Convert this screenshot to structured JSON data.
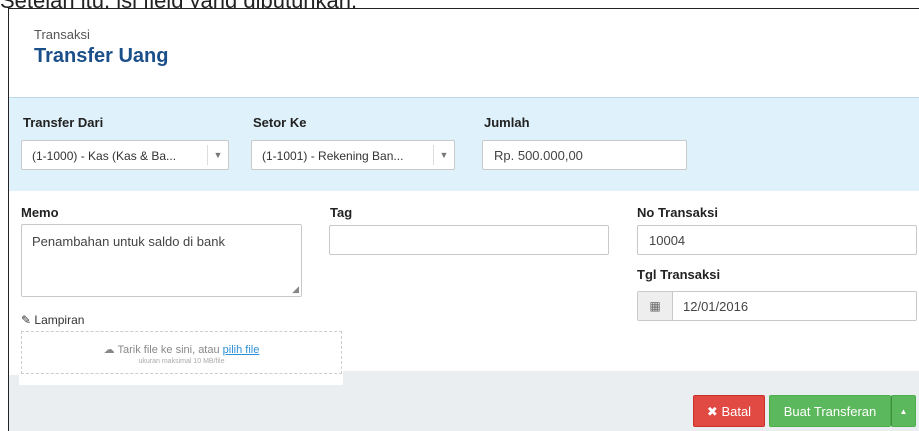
{
  "caption": "Setelah itu, isi field yang dibutuhkan.",
  "header": {
    "subtitle": "Transaksi",
    "title": "Transfer Uang"
  },
  "transfer": {
    "from_label": "Transfer Dari",
    "from_value": "(1-1000) - Kas (Kas & Ba...",
    "to_label": "Setor Ke",
    "to_value": "(1-1001) - Rekening Ban...",
    "amount_label": "Jumlah",
    "amount_value": "Rp. 500.000,00"
  },
  "details": {
    "memo_label": "Memo",
    "memo_value": "Penambahan untuk saldo di bank",
    "tag_label": "Tag",
    "tag_value": "",
    "no_label": "No Transaksi",
    "no_value": "10004",
    "date_label": "Tgl Transaksi",
    "date_value": "12/01/2016"
  },
  "attachment": {
    "label": "Lampiran",
    "drop_text": "Tarik file ke sini, atau",
    "drop_link": "pilih file",
    "drop_hint": "ukuran maksimal 10 MB/file"
  },
  "actions": {
    "cancel_label": "Batal",
    "create_label": "Buat Transferan"
  },
  "icons": {
    "caret": "caret-down-icon",
    "calendar": "calendar-icon",
    "paperclip": "paperclip-icon",
    "cloud": "cloud-upload-icon",
    "times": "times-icon",
    "caret_up": "caret-up-icon"
  }
}
